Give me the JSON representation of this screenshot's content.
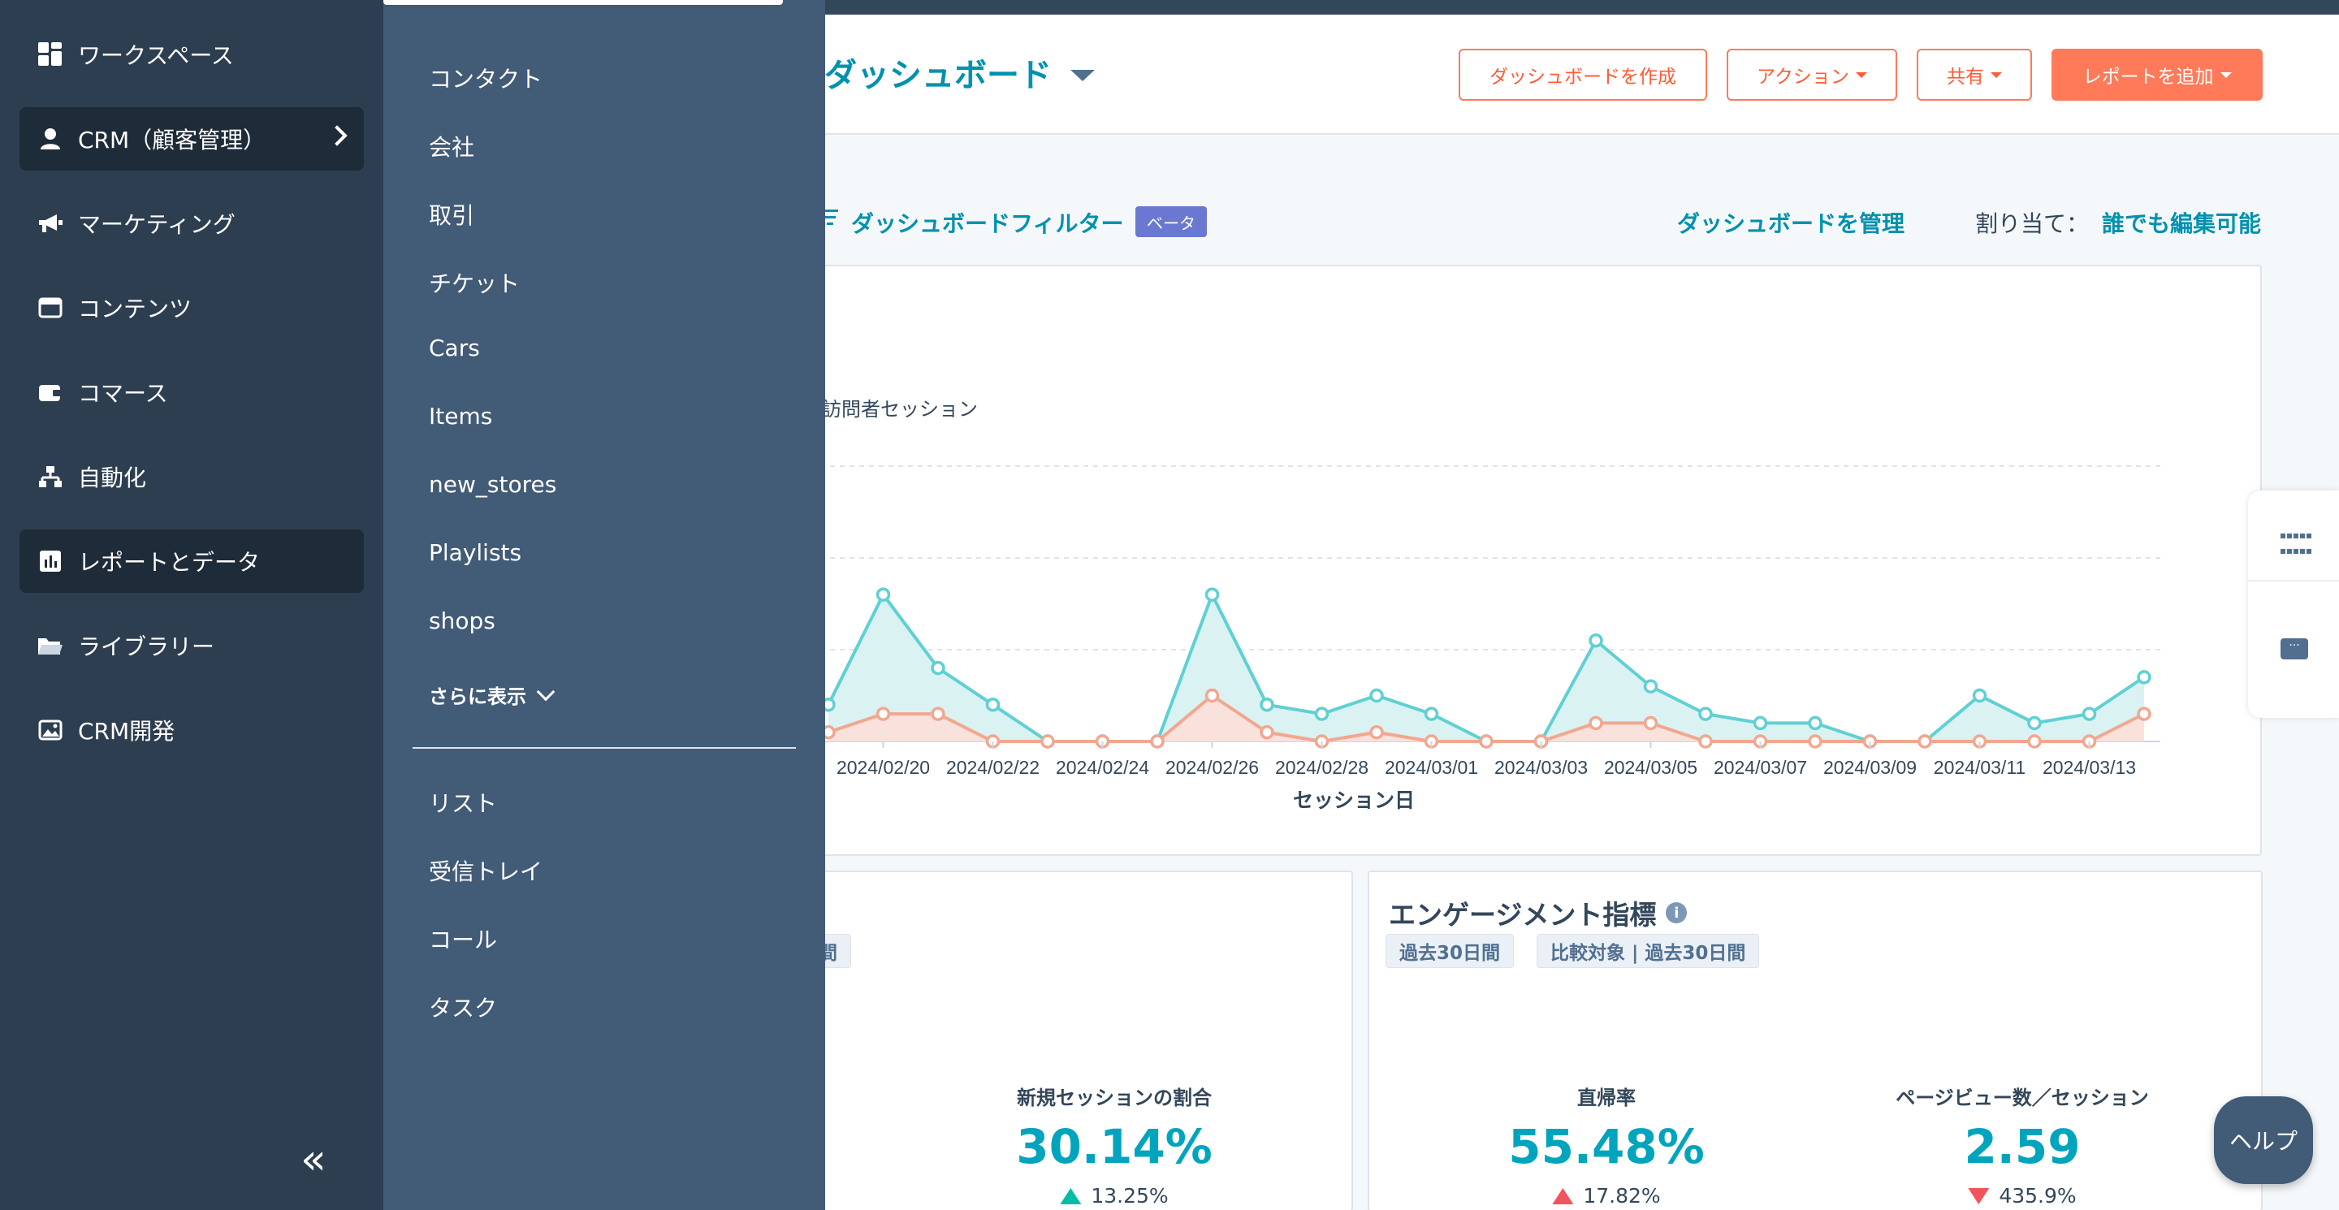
{
  "sidebar": {
    "items": [
      {
        "label": "ワークスペース",
        "icon": "grid-icon",
        "active": false
      },
      {
        "label": "CRM（顧客管理）",
        "icon": "person-icon",
        "active": true
      },
      {
        "label": "マーケティング",
        "icon": "megaphone-icon",
        "active": false
      },
      {
        "label": "コンテンツ",
        "icon": "window-icon",
        "active": false
      },
      {
        "label": "コマース",
        "icon": "wallet-icon",
        "active": false
      },
      {
        "label": "自動化",
        "icon": "workflow-icon",
        "active": false
      },
      {
        "label": "レポートとデータ",
        "icon": "bar-chart-icon",
        "active": true
      },
      {
        "label": "ライブラリー",
        "icon": "folder-icon",
        "active": false
      },
      {
        "label": "CRM開発",
        "icon": "image-icon",
        "active": false
      }
    ],
    "collapse_glyph": "«"
  },
  "flyout": {
    "items": [
      "コンタクト",
      "会社",
      "取引",
      "チケット",
      "Cars",
      "Items",
      "new_stores",
      "Playlists",
      "shops"
    ],
    "show_more": "さらに表示",
    "items_after": [
      "リスト",
      "受信トレイ",
      "コール",
      "タスク"
    ]
  },
  "header": {
    "title": "ダッシュボード",
    "buttons": {
      "create": "ダッシュボードを作成",
      "actions": "アクション",
      "share": "共有",
      "add_report": "レポートを追加"
    }
  },
  "filter_bar": {
    "label": "ダッシュボードフィルター",
    "badge": "ベータ",
    "manage": "ダッシュボードを管理",
    "assign_label": "割り当て：",
    "assign_value": "誰でも編集可能"
  },
  "chart": {
    "legend_partial": "訪問者セッション",
    "xlabel": "セッション日"
  },
  "chart_data": {
    "type": "area",
    "x": [
      "2024/02/19",
      "2024/02/20",
      "2024/02/21",
      "2024/02/22",
      "2024/02/23",
      "2024/02/24",
      "2024/02/25",
      "2024/02/26",
      "2024/02/27",
      "2024/02/28",
      "2024/02/29",
      "2024/03/01",
      "2024/03/02",
      "2024/03/03",
      "2024/03/04",
      "2024/03/05",
      "2024/03/06",
      "2024/03/07",
      "2024/03/08",
      "2024/03/09",
      "2024/03/10",
      "2024/03/11",
      "2024/03/12",
      "2024/03/13",
      "2024/03/14"
    ],
    "tick_labels": [
      "2024/02/20",
      "2024/02/22",
      "2024/02/24",
      "2024/02/26",
      "2024/02/28",
      "2024/03/01",
      "2024/03/03",
      "2024/03/05",
      "2024/03/07",
      "2024/03/09",
      "2024/03/11",
      "2024/03/13"
    ],
    "series": [
      {
        "values": [
          4,
          16,
          8,
          4,
          0,
          0,
          0,
          16,
          4,
          3,
          5,
          3,
          0,
          0,
          11,
          6,
          3,
          2,
          2,
          0,
          0,
          5,
          2,
          3,
          7
        ],
        "color": "#5fd0d3",
        "fill": "#d7f1f2"
      },
      {
        "values": [
          1,
          3,
          3,
          0,
          0,
          0,
          0,
          5,
          1,
          0,
          1,
          0,
          0,
          0,
          2,
          2,
          0,
          0,
          0,
          0,
          0,
          0,
          0,
          0,
          3
        ],
        "color": "#f2a78f",
        "fill": "#fbe0d8"
      }
    ],
    "ylim": [
      0,
      30
    ],
    "grid": true
  },
  "engagement": {
    "title": "エンゲージメント指標",
    "chips": [
      "過去30日間",
      "比較対象 | 過去30日間"
    ],
    "left_chip_partial": "間"
  },
  "stats": [
    {
      "label": "新規セッションの割合",
      "value": "30.14%",
      "change": "13.25%",
      "direction": "up",
      "color": "#00bda5"
    },
    {
      "label": "直帰率",
      "value": "55.48%",
      "change": "17.82%",
      "direction": "up",
      "color": "#f2545b"
    },
    {
      "label": "ページビュー数／セッション",
      "value": "2.59",
      "change": "435.9%",
      "direction": "down",
      "color": "#f2545b"
    }
  ],
  "help": "ヘルプ"
}
